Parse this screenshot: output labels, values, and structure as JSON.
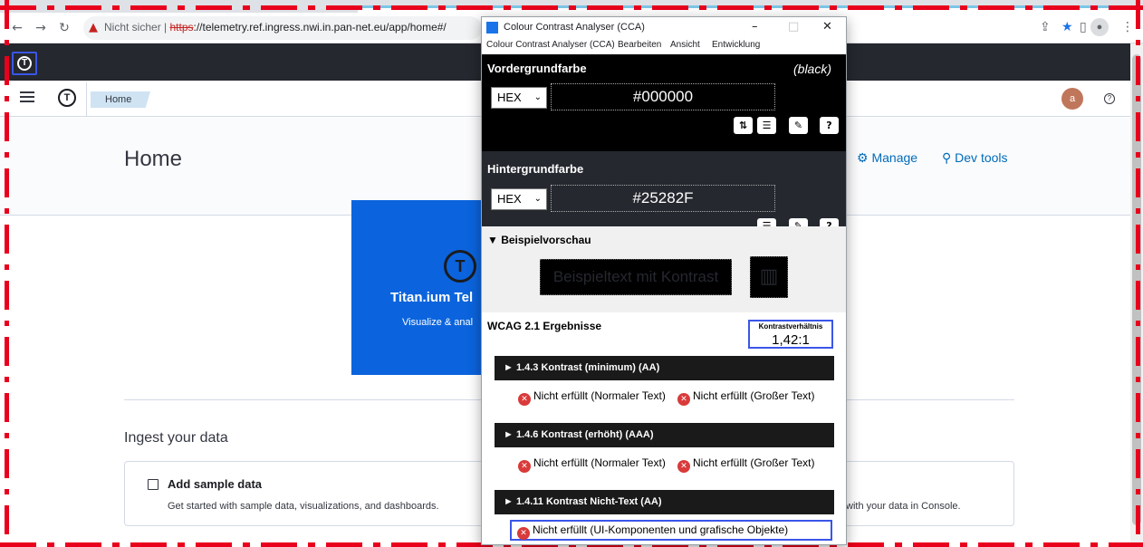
{
  "browser": {
    "url_warning": "Nicht sicher",
    "url_scheme": "https",
    "url_rest": "://telemetry.ref.ingress.nwi.in.pan-net.eu/app/home#/"
  },
  "app": {
    "breadcrumb": "Home",
    "user_initial": "a",
    "page_title": "Home",
    "manage_link": "Manage",
    "devtools_link": "Dev tools",
    "hero_title": "Titan.ium Tel",
    "hero_subtitle": "Visualize & anal",
    "ingest_title": "Ingest your data",
    "sample_title": "Add sample data",
    "sample_desc": "Get started with sample data, visualizations, and dashboards.",
    "console_desc": "with your data in Console."
  },
  "cca": {
    "window_title": "Colour Contrast Analyser (CCA)",
    "menu": [
      "Colour Contrast Analyser (CCA)",
      "Bearbeiten",
      "Ansicht",
      "Entwicklung"
    ],
    "foreground": {
      "title": "Vordergrundfarbe",
      "name": "(black)",
      "format": "HEX",
      "value": "#000000",
      "color": "#000000"
    },
    "background": {
      "title": "Hintergrundfarbe",
      "format": "HEX",
      "value": "#25282F",
      "color": "#25282F"
    },
    "preview": {
      "title": "▼ Beispielvorschau",
      "sample_text": "Beispieltext mit Kontrast"
    },
    "wcag": {
      "title": "WCAG 2.1 Ergebnisse",
      "ratio_label": "Kontrastverhältnis",
      "ratio_value": "1,42:1",
      "criteria": [
        {
          "label": "► 1.4.3 Kontrast (minimum) (AA)",
          "normal": "Nicht erfüllt (Normaler Text)",
          "large": "Nicht erfüllt (Großer Text)"
        },
        {
          "label": "► 1.4.6 Kontrast (erhöht) (AAA)",
          "normal": "Nicht erfüllt (Normaler Text)",
          "large": "Nicht erfüllt (Großer Text)"
        },
        {
          "label": "► 1.4.11 Kontrast Nicht-Text (AA)",
          "result": "Nicht erfüllt (UI-Komponenten und grafische Objekte)"
        }
      ]
    }
  }
}
